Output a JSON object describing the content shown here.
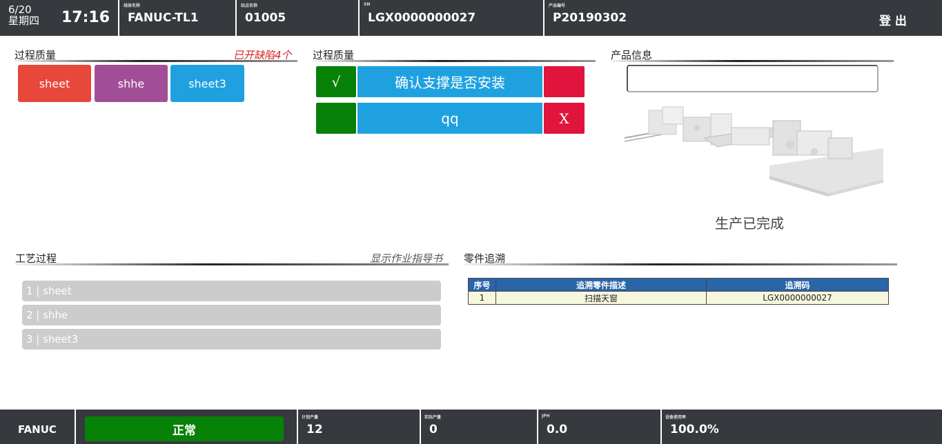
{
  "header": {
    "date": "6/20",
    "weekday": "星期四",
    "time": "17:16",
    "line_caption": "线体名称",
    "line_value": "FANUC-TL1",
    "station_caption": "站点名称",
    "station_value": "01005",
    "sn_caption": "SN",
    "sn_value": "LGX0000000027",
    "product_caption": "产品编号",
    "product_value": "P20190302",
    "logout_label": "登 出"
  },
  "process_quality_left": {
    "title": "过程质量",
    "defect_notice": "已开缺陷4个",
    "buttons": [
      {
        "label": "sheet",
        "color": "#e8473b"
      },
      {
        "label": "shhe",
        "color": "#a24e97"
      },
      {
        "label": "sheet3",
        "color": "#1fa1e0"
      }
    ]
  },
  "process_quality_right": {
    "title": "过程质量",
    "items": [
      {
        "ok_label": "√",
        "text": "确认支撑是否安装",
        "ng_label": ""
      },
      {
        "ok_label": "",
        "text": "qq",
        "ng_label": "X"
      }
    ]
  },
  "product_info": {
    "title": "产品信息",
    "input_value": "",
    "status_text": "生产已完成"
  },
  "process_steps": {
    "title": "工艺过程",
    "guide_link": "显示作业指导书",
    "steps": [
      "1 | sheet",
      "2 | shhe",
      "3 | sheet3"
    ]
  },
  "part_trace": {
    "title": "零件追溯",
    "columns": [
      "序号",
      "追溯零件描述",
      "追溯码"
    ],
    "rows": [
      [
        "1",
        "扫描天窗",
        "LGX0000000027"
      ]
    ]
  },
  "footer": {
    "brand": "FANUC",
    "status": "正常",
    "plan_caption": "计划产量",
    "plan_value": "12",
    "actual_caption": "实际产量",
    "actual_value": "0",
    "jph_caption": "JPH",
    "jph_value": "0.0",
    "util_caption": "设备使用率",
    "util_value": "100.0%"
  },
  "colors": {
    "bar_bg": "#36393e",
    "ok_green": "#078107",
    "ng_red": "#e0143c",
    "accent_blue": "#1fa1e0",
    "table_header": "#2a64a9"
  }
}
